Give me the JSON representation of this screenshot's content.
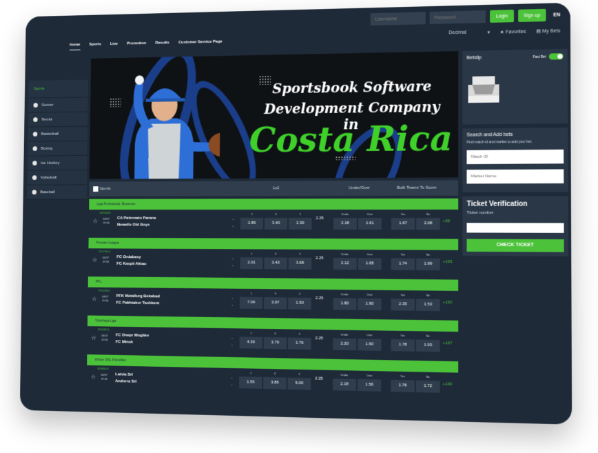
{
  "auth": {
    "username_placeholder": "Username",
    "password_placeholder": "Password",
    "login_label": "Login",
    "signup_label": "Sign up",
    "language": "EN"
  },
  "nav": {
    "items": [
      "Home",
      "Sports",
      "Live",
      "Promotion",
      "Results",
      "Customer Service Page"
    ]
  },
  "tools": {
    "odds_format": "Decimal",
    "favorites_label": "Favorites",
    "mybets_label": "My Bets"
  },
  "sidebar": {
    "title": "Sports",
    "items": [
      "Soccer",
      "Tennis",
      "Basketball",
      "Boxing",
      "Ice Hockey",
      "Volleyball",
      "Baseball"
    ]
  },
  "banner": {
    "line1": "Sportsbook Software",
    "line2": "Development Company in",
    "line3": "Costa Rica"
  },
  "table": {
    "headers": {
      "sports": "Sports",
      "onextwo": "1x2",
      "under_over": "Under/Over",
      "btts": "Both Teams To Score"
    },
    "odds_labels": [
      "1",
      "X",
      "2",
      "Under",
      "Over",
      "Yes",
      "No"
    ],
    "matches": [
      {
        "league": "Liga Profesional, Reserves",
        "match_id": "14814496",
        "date": "04/07",
        "time": "19:30",
        "home": "CA Patronato Parana",
        "away": "Newells Old Boys",
        "odds": [
          "2.89",
          "3.40",
          "2.39"
        ],
        "line": "2.25",
        "uo": [
          "2.18",
          "1.61"
        ],
        "btts": [
          "1.67",
          "2.08"
        ],
        "more": "+50"
      },
      {
        "league": "Premier League",
        "match_id": "22177053",
        "date": "04/07",
        "time": "19:30",
        "home": "FC Ordabasy",
        "away": "FC Kaspii Aktau",
        "odds": [
          "2.01",
          "3.43",
          "3.68"
        ],
        "line": "2.25",
        "uo": [
          "2.12",
          "1.65"
        ],
        "btts": [
          "1.74",
          "1.99"
        ],
        "more": "+103"
      },
      {
        "league": "PFL",
        "match_id": "31051600",
        "date": "04/07",
        "time": "19:30",
        "home": "PFK Metallurg Bekabad",
        "away": "FC Pakhtakor Tashkent",
        "odds": [
          "7.04",
          "3.97",
          "1.50"
        ],
        "line": "2.25",
        "uo": [
          "1.80",
          "1.90"
        ],
        "btts": [
          "2.35",
          "1.53"
        ],
        "more": "+102"
      },
      {
        "league": "Vysshaya Liga",
        "match_id": "32643315",
        "date": "04/07",
        "time": "20:30",
        "home": "FC Dnepr Mogilev",
        "away": "FC Minsk",
        "odds": [
          "4.39",
          "3.79",
          "1.76"
        ],
        "line": "2.25",
        "uo": [
          "2.20",
          "1.60"
        ],
        "btts": [
          "1.78",
          "1.93"
        ],
        "more": "+107"
      },
      {
        "league": "Winter SRL Friendlies",
        "match_id": "34383013",
        "date": "04/07",
        "time": "19:30",
        "home": "Latvia Srl",
        "away": "Andorra Srl",
        "odds": [
          "1.55",
          "3.85",
          "5.00"
        ],
        "line": "2.25",
        "uo": [
          "2.18",
          "1.56"
        ],
        "btts": [
          "1.76",
          "1.72"
        ],
        "more": "+100"
      }
    ]
  },
  "betslip": {
    "title": "Betslip",
    "fast_bet_label": "Fast Bet"
  },
  "search_bets": {
    "title": "Search and Add bets",
    "hint": "Find match id and market to add your bet.",
    "match_id_placeholder": "Match ID",
    "market_name_placeholder": "Market Name"
  },
  "ticket": {
    "title": "Ticket Verification",
    "number_label": "Ticket number",
    "check_label": "CHECK TICKET"
  },
  "colors": {
    "accent": "#4cc23a",
    "bg": "#1e2a38",
    "panel": "#2a3747"
  }
}
